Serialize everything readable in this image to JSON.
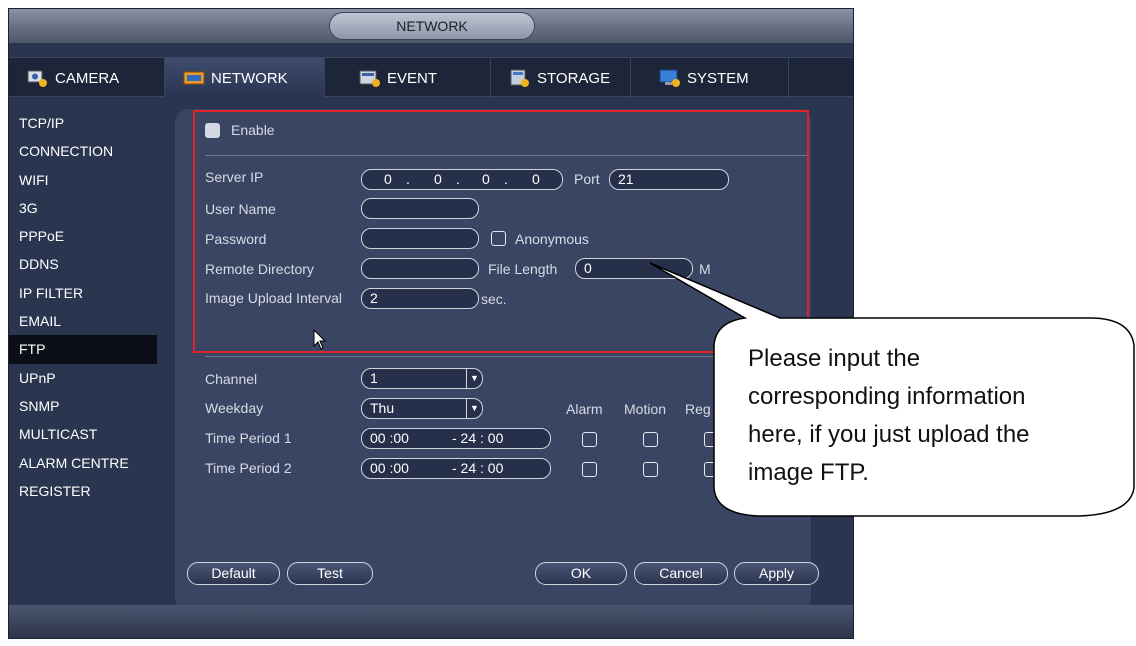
{
  "window": {
    "title": "NETWORK"
  },
  "tabs": [
    {
      "label": "CAMERA",
      "icon": "camera-icon"
    },
    {
      "label": "NETWORK",
      "icon": "network-icon"
    },
    {
      "label": "EVENT",
      "icon": "event-icon"
    },
    {
      "label": "STORAGE",
      "icon": "storage-icon"
    },
    {
      "label": "SYSTEM",
      "icon": "system-icon"
    }
  ],
  "sidebar": {
    "items": [
      "TCP/IP",
      "CONNECTION",
      "WIFI",
      "3G",
      "PPPoE",
      "DDNS",
      "IP FILTER",
      "EMAIL",
      "FTP",
      "UPnP",
      "SNMP",
      "MULTICAST",
      "ALARM CENTRE",
      "REGISTER"
    ],
    "active": "FTP"
  },
  "form": {
    "enable_label": "Enable",
    "server_ip_label": "Server IP",
    "server_ip": [
      "0",
      "0",
      "0",
      "0"
    ],
    "ip_dot": ".",
    "port_label": "Port",
    "port_value": "21",
    "username_label": "User Name",
    "username_value": "",
    "password_label": "Password",
    "password_value": "",
    "anonymous_label": "Anonymous",
    "remote_dir_label": "Remote Directory",
    "remote_dir_value": "",
    "file_length_label": "File Length",
    "file_length_value": "0",
    "file_length_unit": "M",
    "upload_interval_label": "Image Upload Interval",
    "upload_interval_value": "2",
    "upload_interval_unit": "sec."
  },
  "schedule": {
    "channel_label": "Channel",
    "channel_value": "1",
    "weekday_label": "Weekday",
    "weekday_value": "Thu",
    "col_alarm": "Alarm",
    "col_motion": "Motion",
    "col_regular": "Reg",
    "periods": [
      {
        "label": "Time Period 1",
        "start": "00 :00",
        "end": "- 24 : 00"
      },
      {
        "label": "Time Period 2",
        "start": "00 :00",
        "end": "- 24 : 00"
      }
    ]
  },
  "buttons": {
    "default": "Default",
    "test": "Test",
    "ok": "OK",
    "cancel": "Cancel",
    "apply": "Apply"
  },
  "callout": {
    "lines": [
      "Please input the",
      "corresponding information",
      "here, if you just upload the",
      "image FTP."
    ]
  },
  "colors": {
    "highlight_box": "#e0222a",
    "window_bg": "#2a3550",
    "panel_bg": "#3a4563"
  }
}
